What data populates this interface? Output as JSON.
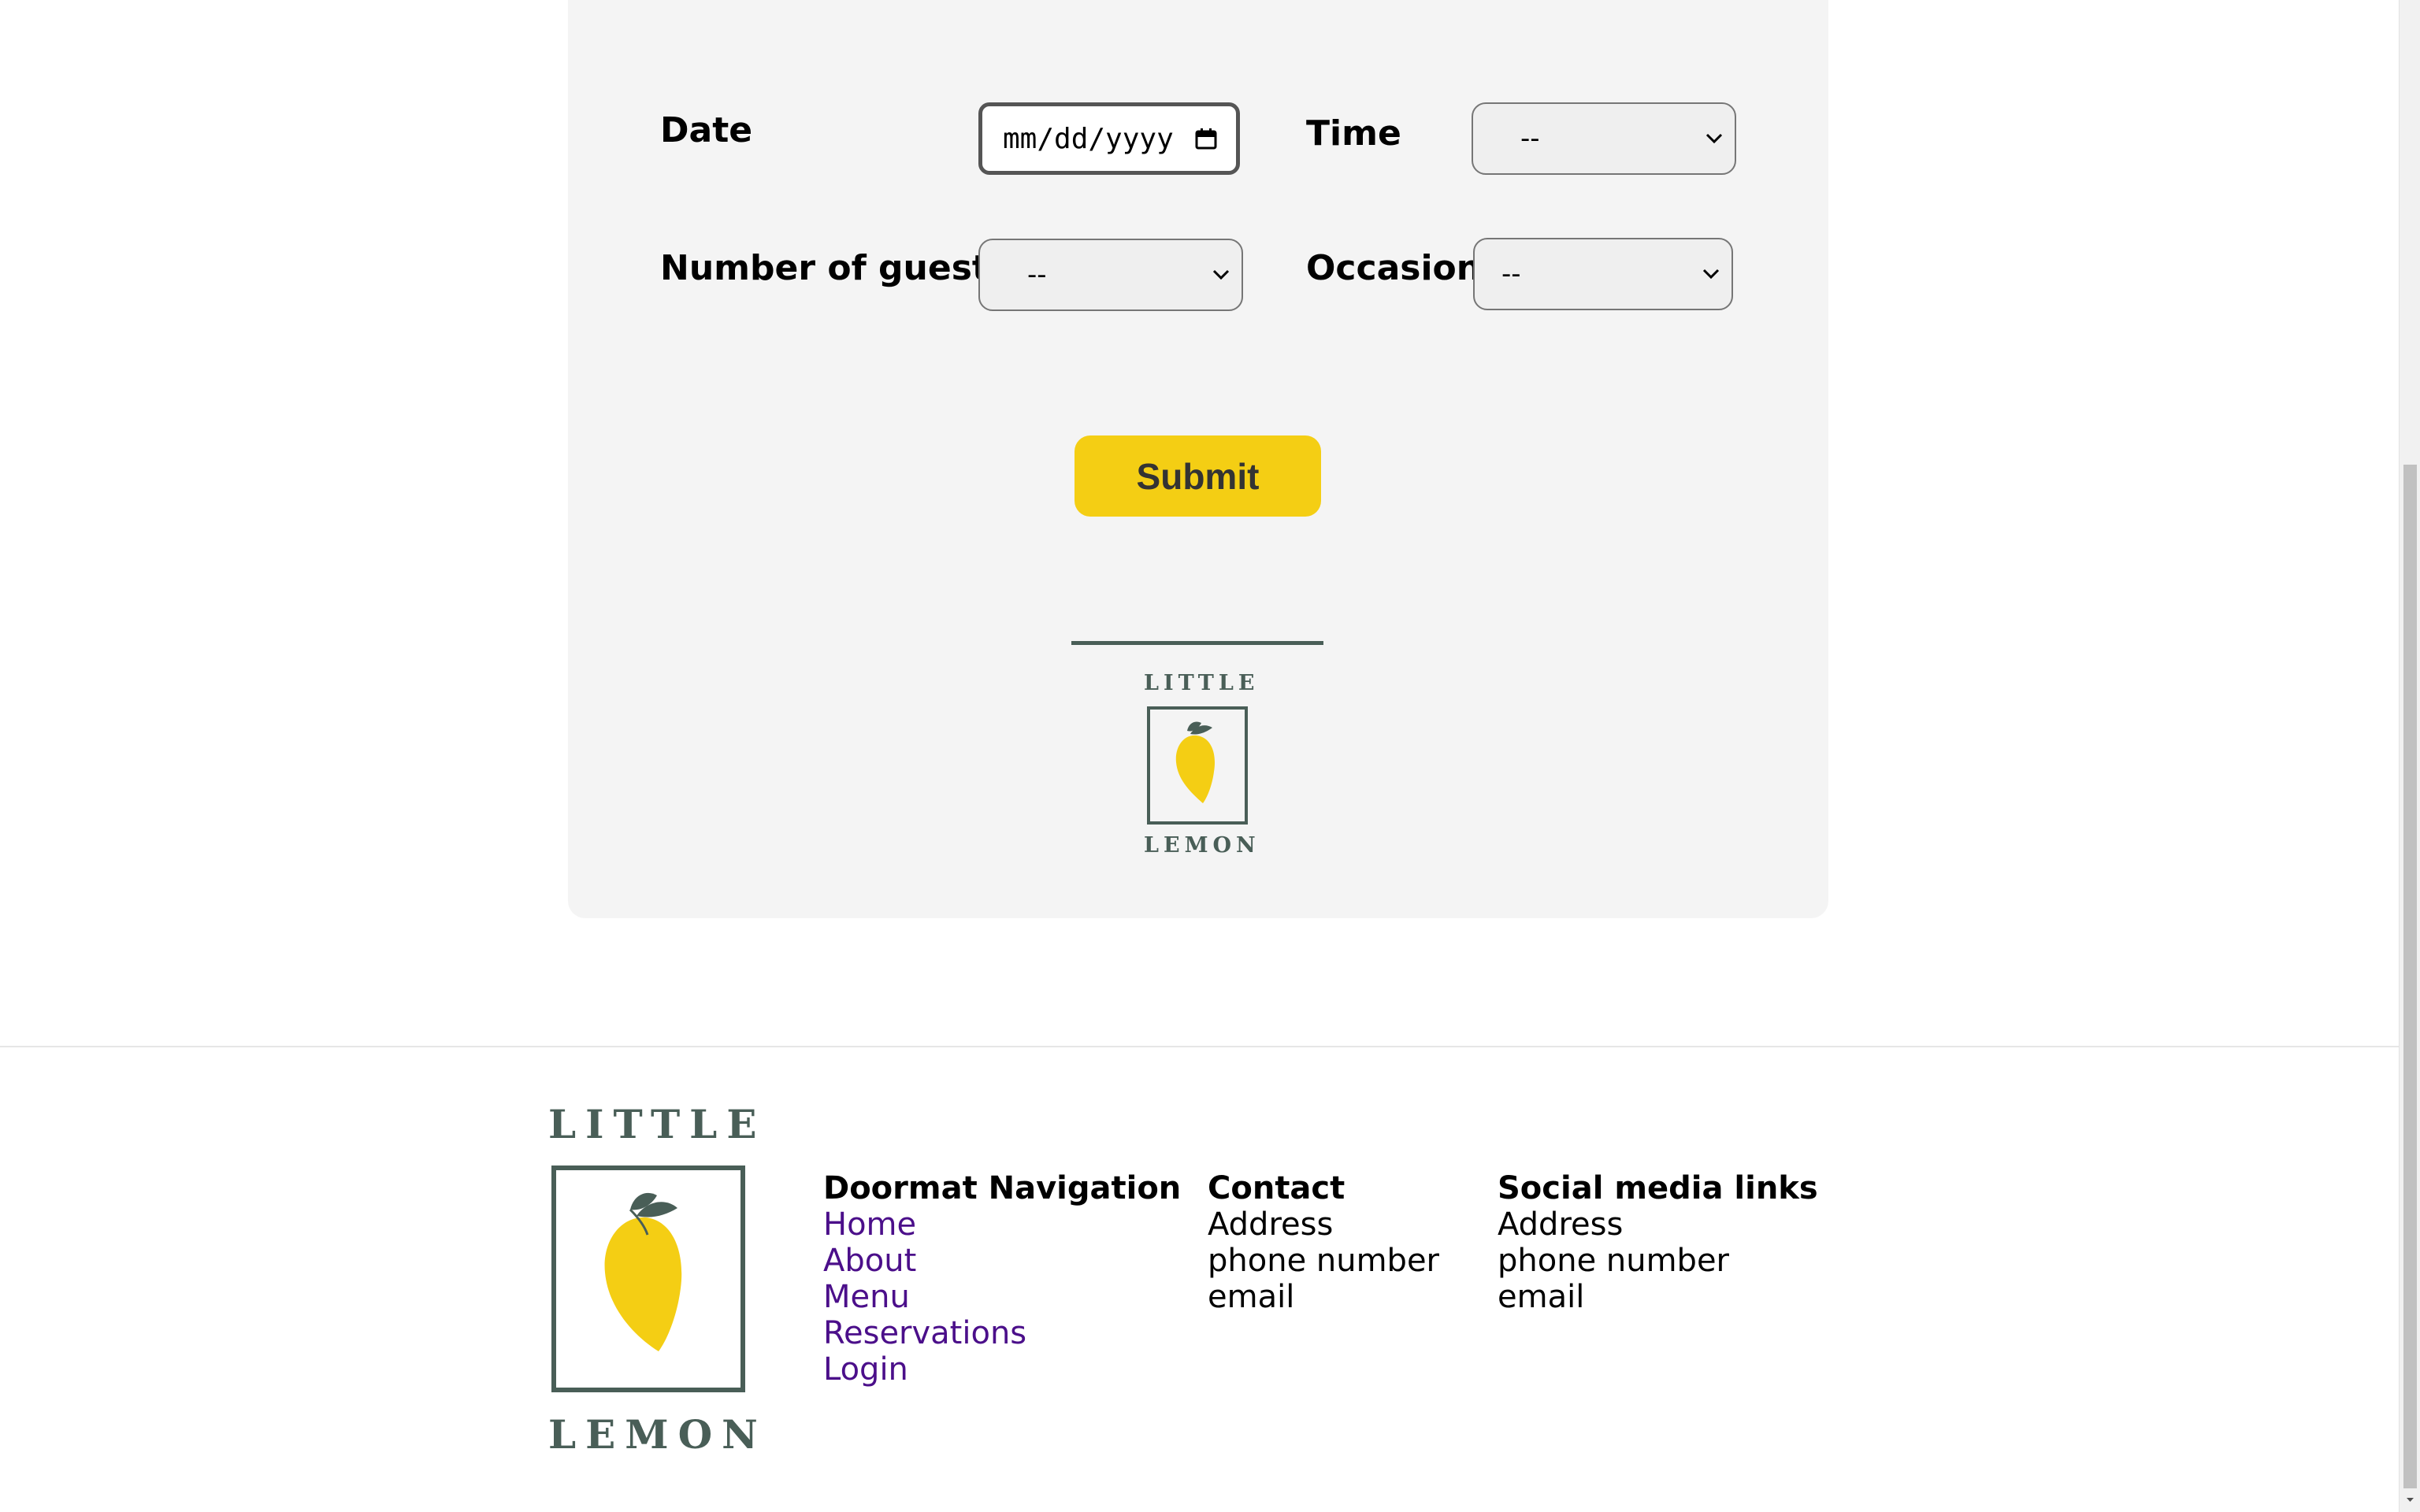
{
  "form": {
    "date_label": "Date",
    "date_placeholder": "mm/dd/yyyy",
    "time_label": "Time",
    "time_value": "--",
    "guests_label": "Number of guests",
    "guests_value": "--",
    "occasion_label": "Occasion",
    "occasion_value": "--",
    "submit_label": "Submit"
  },
  "logo": {
    "top_word": "LITTLE",
    "bottom_word": "LEMON",
    "colors": {
      "frame": "#495e57",
      "lemon": "#f4ce14",
      "leaf": "#495e57"
    }
  },
  "footer": {
    "navigation": {
      "heading": "Doormat Navigation",
      "links": [
        "Home",
        "About",
        "Menu",
        "Reservations",
        "Login"
      ]
    },
    "contact": {
      "heading": "Contact",
      "lines": [
        "Address",
        "phone number",
        "email"
      ]
    },
    "social": {
      "heading": "Social media links",
      "lines": [
        "Address",
        "phone number",
        "email"
      ]
    }
  },
  "colors": {
    "accent": "#f4ce14",
    "brand_green": "#495e57",
    "link": "#4b0f8a",
    "card_bg": "#f4f4f4"
  },
  "icons": {
    "calendar": "calendar-icon",
    "dropdown": "chevron-down-icon"
  }
}
